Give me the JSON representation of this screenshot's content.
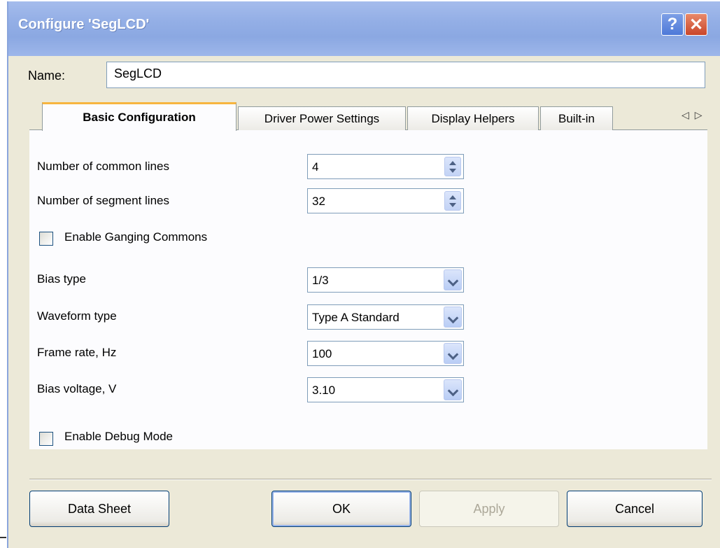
{
  "window": {
    "title": "Configure 'SegLCD'"
  },
  "titlebar": {
    "help_label": "?",
    "close_label": "✕"
  },
  "name": {
    "label": "Name:",
    "value": "SegLCD"
  },
  "tabs": [
    {
      "label": "Basic Configuration",
      "active": true
    },
    {
      "label": "Driver Power Settings",
      "active": false
    },
    {
      "label": "Display Helpers",
      "active": false
    },
    {
      "label": "Built-in",
      "active": false
    }
  ],
  "tab_scroll": {
    "arrows": "◁▷"
  },
  "fields": {
    "common_lines": {
      "label": "Number of common lines",
      "value": "4"
    },
    "segment_lines": {
      "label": "Number of segment lines",
      "value": "32"
    },
    "ganging": {
      "label": "Enable Ganging Commons",
      "checked": false
    },
    "bias_type": {
      "label": "Bias type",
      "value": "1/3"
    },
    "waveform_type": {
      "label": "Waveform type",
      "value": "Type A Standard"
    },
    "frame_rate": {
      "label": "Frame rate, Hz",
      "value": "100"
    },
    "bias_voltage": {
      "label": "Bias voltage, V",
      "value": "3.10"
    },
    "debug_mode": {
      "label": "Enable Debug Mode",
      "checked": false
    }
  },
  "buttons": {
    "datasheet": "Data Sheet",
    "ok": "OK",
    "apply": "Apply",
    "cancel": "Cancel"
  },
  "colors": {
    "titlebar": "#94afe6",
    "dialog_bg": "#ece9d8",
    "active_tab_accent": "#f7b53f"
  }
}
